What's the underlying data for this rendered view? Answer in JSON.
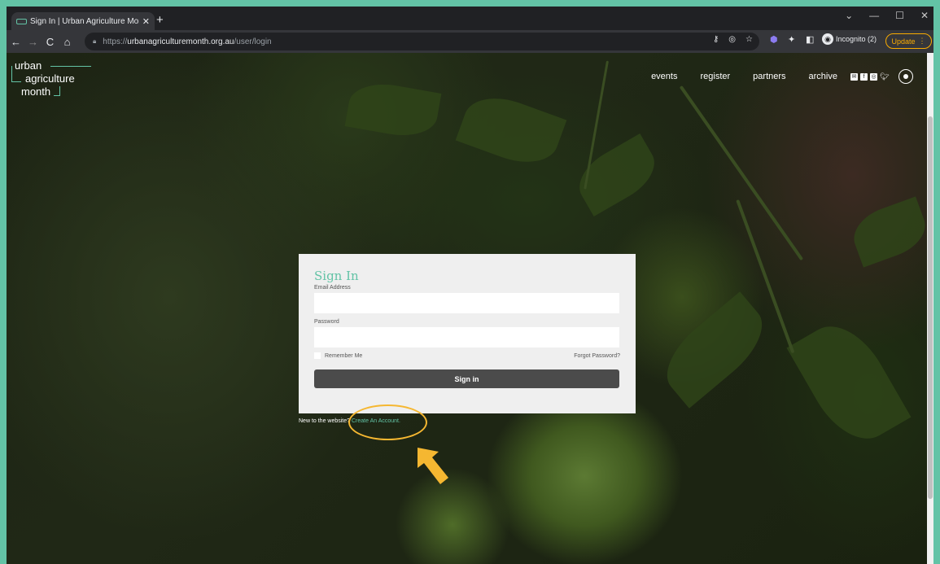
{
  "browser": {
    "tab_title": "Sign In | Urban Agriculture Mont",
    "tab_close": "✕",
    "new_tab": "+",
    "url_prefix": "https://",
    "url_host": "urbanagriculturemonth.org.au",
    "url_path": "/user/login",
    "incognito_label": "Incognito (2)",
    "update_label": "Update",
    "win_minimize": "—",
    "win_maximize": "☐",
    "win_close": "✕",
    "win_menu": "⌄"
  },
  "site": {
    "logo": {
      "line1": "urban",
      "line2": "agriculture",
      "line3": "month"
    },
    "nav": {
      "events": "events",
      "register": "register",
      "partners": "partners",
      "archive": "archive"
    },
    "accent_color": "#63c3a6"
  },
  "signin": {
    "title": "Sign In",
    "email_label": "Email Address",
    "email_value": "",
    "password_label": "Password",
    "password_value": "",
    "remember_label": "Remember Me",
    "forgot_label": "Forgot Password?",
    "button_label": "Sign in",
    "new_prefix": "New to the website?",
    "create_link": "Create An Account."
  },
  "annotation": {
    "highlight_color": "#f5b731"
  }
}
